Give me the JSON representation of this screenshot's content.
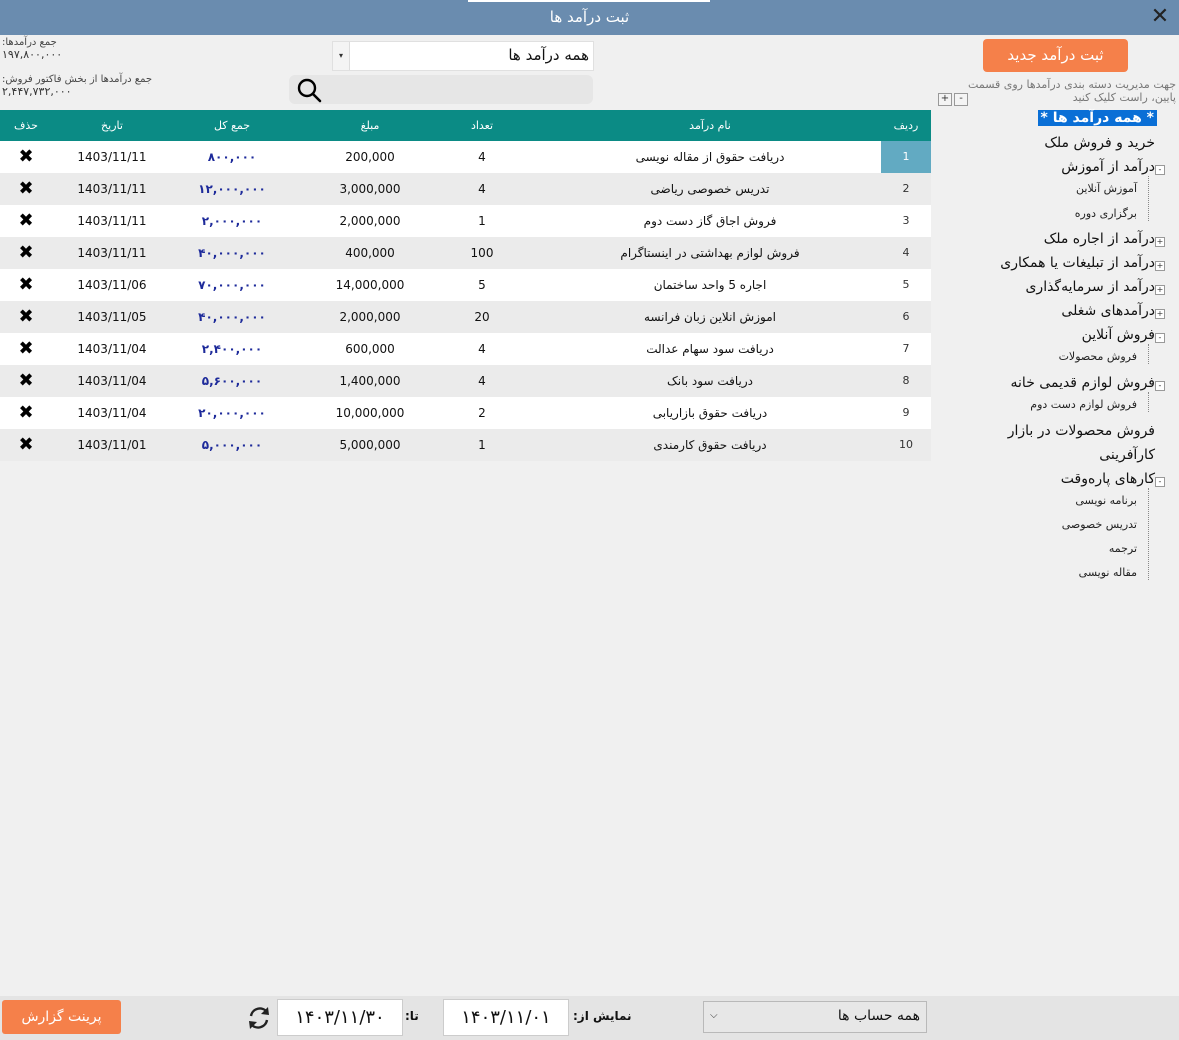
{
  "window": {
    "title": "ثبت درآمد ها",
    "close_glyph": "✕"
  },
  "summary": {
    "total_label": "جمع درآمدها:",
    "total_value": "۱۹۷,۸۰۰,۰۰۰",
    "invoice_label": "جمع درآمدها از بخش فاکتور فروش:",
    "invoice_value": "۲,۴۴۷,۷۳۲,۰۰۰"
  },
  "filter": {
    "selected": "همه درآمد ها",
    "arrow": "▾"
  },
  "search": {
    "placeholder": "",
    "icon": "search-icon"
  },
  "new_button": {
    "label": "ثبت درآمد جدید"
  },
  "hint": "جهت مدیریت دسته بندی درآمدها روی قسمت پایین، راست کلیک کنید",
  "tree_buttons": {
    "plus": "+",
    "minus": "-"
  },
  "table": {
    "headers": {
      "delete": "حذف",
      "date": "تاریخ",
      "total": "جمع کل",
      "amount": "مبلغ",
      "count": "تعداد",
      "name": "نام درآمد",
      "row": "ردیف"
    },
    "delete_glyph": "✖",
    "rows": [
      {
        "row": "1",
        "name": "دریافت حقوق از مقاله نویسی",
        "count": "4",
        "amount": "200,000",
        "total": "۸۰۰,۰۰۰",
        "date": "1403/11/11"
      },
      {
        "row": "2",
        "name": "تدریس خصوصی ریاضی",
        "count": "4",
        "amount": "3,000,000",
        "total": "۱۲,۰۰۰,۰۰۰",
        "date": "1403/11/11"
      },
      {
        "row": "3",
        "name": "فروش اجاق گاز دست دوم",
        "count": "1",
        "amount": "2,000,000",
        "total": "۲,۰۰۰,۰۰۰",
        "date": "1403/11/11"
      },
      {
        "row": "4",
        "name": "فروش لوازم بهداشتی در اینستاگرام",
        "count": "100",
        "amount": "400,000",
        "total": "۴۰,۰۰۰,۰۰۰",
        "date": "1403/11/11"
      },
      {
        "row": "5",
        "name": "اجاره 5 واحد ساختمان",
        "count": "5",
        "amount": "14,000,000",
        "total": "۷۰,۰۰۰,۰۰۰",
        "date": "1403/11/06"
      },
      {
        "row": "6",
        "name": "اموزش انلاین زبان فرانسه",
        "count": "20",
        "amount": "2,000,000",
        "total": "۴۰,۰۰۰,۰۰۰",
        "date": "1403/11/05"
      },
      {
        "row": "7",
        "name": "دریافت سود سهام عدالت",
        "count": "4",
        "amount": "600,000",
        "total": "۲,۴۰۰,۰۰۰",
        "date": "1403/11/04"
      },
      {
        "row": "8",
        "name": "دریافت سود بانک",
        "count": "4",
        "amount": "1,400,000",
        "total": "۵,۶۰۰,۰۰۰",
        "date": "1403/11/04"
      },
      {
        "row": "9",
        "name": "دریافت حقوق بازاریابی",
        "count": "2",
        "amount": "10,000,000",
        "total": "۲۰,۰۰۰,۰۰۰",
        "date": "1403/11/04"
      },
      {
        "row": "10",
        "name": "دریافت حقوق کارمندی",
        "count": "1",
        "amount": "5,000,000",
        "total": "۵,۰۰۰,۰۰۰",
        "date": "1403/11/01"
      }
    ]
  },
  "tree": {
    "root": "* همه درآمد ها *",
    "n1": "خرید و فروش ملک",
    "n2": "درآمد از آموزش",
    "n2c1": "آموزش آنلاین",
    "n2c2": "برگزاری دوره",
    "n3": "درآمد از اجاره ملک",
    "n4": "درآمد از تبلیغات یا همکاری",
    "n5": "درآمد از سرمایه‌گذاری",
    "n6": "درآمدهای شغلی",
    "n7": "فروش آنلاین",
    "n7c1": "فروش محصولات",
    "n8": "فروش لوازم قدیمی خانه",
    "n8c1": "فروش لوازم دست دوم",
    "n9": "فروش محصولات در بازار",
    "n10": "کارآفرینی",
    "n11": "کارهای پاره‌وقت",
    "n11c1": "برنامه نویسی",
    "n11c2": "تدریس خصوصی",
    "n11c3": "ترجمه",
    "n11c4": "مقاله نویسی",
    "expand_plus": "+",
    "expand_minus": "-"
  },
  "bottom": {
    "print_label": "پرینت گزارش",
    "to_label": "تا:",
    "to_date": "۱۴۰۳/۱۱/۳۰",
    "from_label": "نمایش از:",
    "from_date": "۱۴۰۳/۱۱/۰۱",
    "account_selected": "همه حساب ها",
    "account_arrow": "⌵",
    "refresh_icon": "refresh-icon"
  },
  "colors": {
    "titlebar": "#6a8caf",
    "header": "#0b8b85",
    "accent": "#f5804a",
    "selection": "#0a6fd6",
    "total_text": "#1d2a9a"
  }
}
